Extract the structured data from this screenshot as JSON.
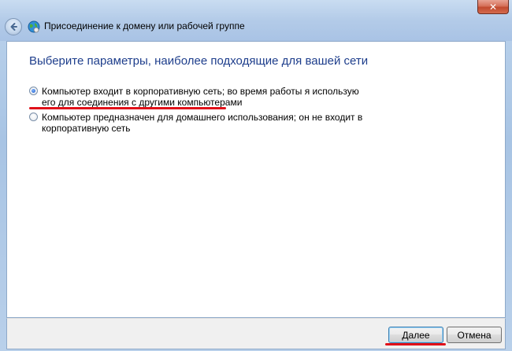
{
  "window": {
    "title": "Присоединение к домену или рабочей группе",
    "close_glyph": "✕"
  },
  "icons": {
    "back": "back-arrow-icon",
    "network": "network-globe-icon",
    "close": "close-icon"
  },
  "main": {
    "heading": "Выберите параметры, наиболее подходящие для вашей сети",
    "options": [
      {
        "label": "Компьютер входит в корпоративную сеть; во время работы я использую его для соединения с другими компьютерами",
        "selected": true
      },
      {
        "label": "Компьютер предназначен для домашнего использования; он не входит в корпоративную сеть",
        "selected": false
      }
    ]
  },
  "footer": {
    "next_label": "Далее",
    "cancel_label": "Отмена"
  },
  "colors": {
    "heading": "#1e3e8c",
    "highlight_underline": "#e0111a"
  }
}
